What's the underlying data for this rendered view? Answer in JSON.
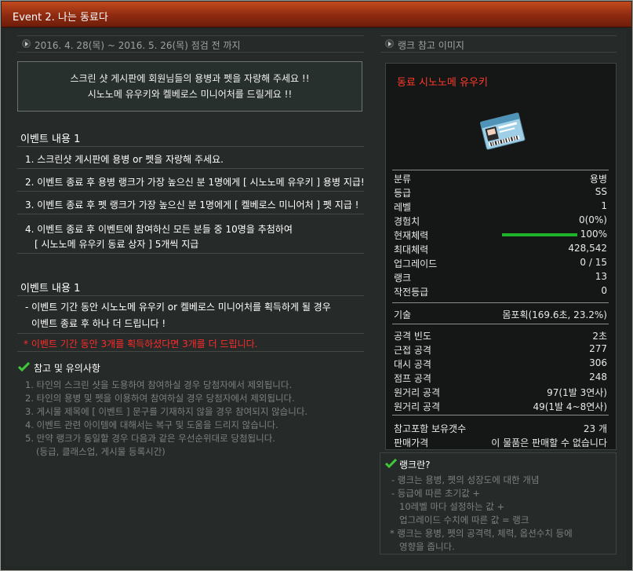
{
  "window": {
    "title": "Event 2. 나는 동료다"
  },
  "period": {
    "text": "2016. 4. 28(목) ~ 2016. 5. 26(목) 점검 전 까지"
  },
  "notice": {
    "line1": "스크린 샷 게시판에 회원님들의 용병과 펫을 자랑해 주세요 !!",
    "line2": "시노노메 유우키와 켈베로스 미니어처를 드릴게요 !!"
  },
  "event1": {
    "title": "이벤트 내용 1",
    "items": [
      "1. 스크린샷 게시판에 용병 or 펫을 자랑해 주세요.",
      "2. 이벤트 종료 후 용병 랭크가 가장 높으신 분 1명에게 [ 시노노메 유우키 ] 용병 지급!",
      "3. 이벤트 종료 후 펫 랭크가 가장 높으신 분 1명에게 [ 켈베로스 미니어처 ] 펫 지급 !",
      "4. 이벤트 종료 후 이벤트에 참여하신 모든 분들 중 10명을 추첨하여",
      "[ 시노노메 유우키 동료 상자 ] 5개씩 지급"
    ]
  },
  "event2": {
    "title": "이벤트 내용 1",
    "line1": "- 이벤트 기간 동안 시노노메 유우키 or 켈베로스 미니어처를 획득하게 될 경우",
    "line2": "이벤트 종료 후 하나 더 드립니다 !",
    "red": "* 이벤트 기간 동안 3개를 획득하셨다면 3개를 더 드립니다."
  },
  "notes": {
    "title": "참고 및 유의사항",
    "items": [
      "1. 타인의 스크린 샷을 도용하여 참여하실 경우 당첨자에서 제외됩니다.",
      "2. 타인의 용병 및 펫을 이용하여 참여하실 경우 당첨자에서 제외됩니다.",
      "3. 게시물 제목에 [ 이벤트 ] 문구를 기재하지 않을 경우 참여되지 않습니다.",
      "4. 이벤트 관련 아이템에 대해서는 복구 및 도움을 드리지 않습니다.",
      "5. 만약 랭크가 동일할 경우 다음과 같은 우선순위대로 당첨됩니다.",
      "(등급, 클래스업, 게시물 등록시간)"
    ]
  },
  "rank_ref": {
    "header": "랭크 참고 이미지",
    "name": "동료 시노노메 유우키",
    "group1": [
      {
        "k": "분류",
        "v": "용병"
      },
      {
        "k": "등급",
        "v": "SS"
      },
      {
        "k": "레벨",
        "v": "1"
      },
      {
        "k": "경험치",
        "v": "0(0%)"
      },
      {
        "k": "현재체력",
        "v": "100%"
      },
      {
        "k": "최대체력",
        "v": "428,542"
      },
      {
        "k": "업그레이드",
        "v": "0 / 15"
      },
      {
        "k": "랭크",
        "v": "13"
      },
      {
        "k": "작전등급",
        "v": "0"
      }
    ],
    "hp_fraction": 1.0,
    "group2": [
      {
        "k": "기술",
        "v": "몸포획(169.6초, 23.2%)"
      }
    ],
    "group3": [
      {
        "k": "공격 빈도",
        "v": "2초"
      },
      {
        "k": "근접 공격",
        "v": "277"
      },
      {
        "k": "대시 공격",
        "v": "306"
      },
      {
        "k": "점프 공격",
        "v": "248"
      },
      {
        "k": "원거리 공격",
        "v": "97(1발 3연사)"
      },
      {
        "k": "원거리 공격",
        "v": "49(1발 4~8연사)"
      }
    ],
    "group4": [
      {
        "k": "참고포함 보유갯수",
        "v": "23 개"
      },
      {
        "k": "판매가격",
        "v": "이 물품은 판매할 수 없습니다"
      }
    ]
  },
  "rank_info": {
    "title": "랭크란?",
    "lines": [
      "- 랭크는 용병, 펫의 성장도에 대한 개념",
      "- 등급에 따른 초기값 +",
      "10레벨 마다 설정하는 값 +",
      "업그레이드 수치에 따른 값 = 랭크",
      "* 랭크는 용병, 펫의 공격력, 체력, 옵션수치 등에",
      "영향을 줍니다."
    ]
  }
}
